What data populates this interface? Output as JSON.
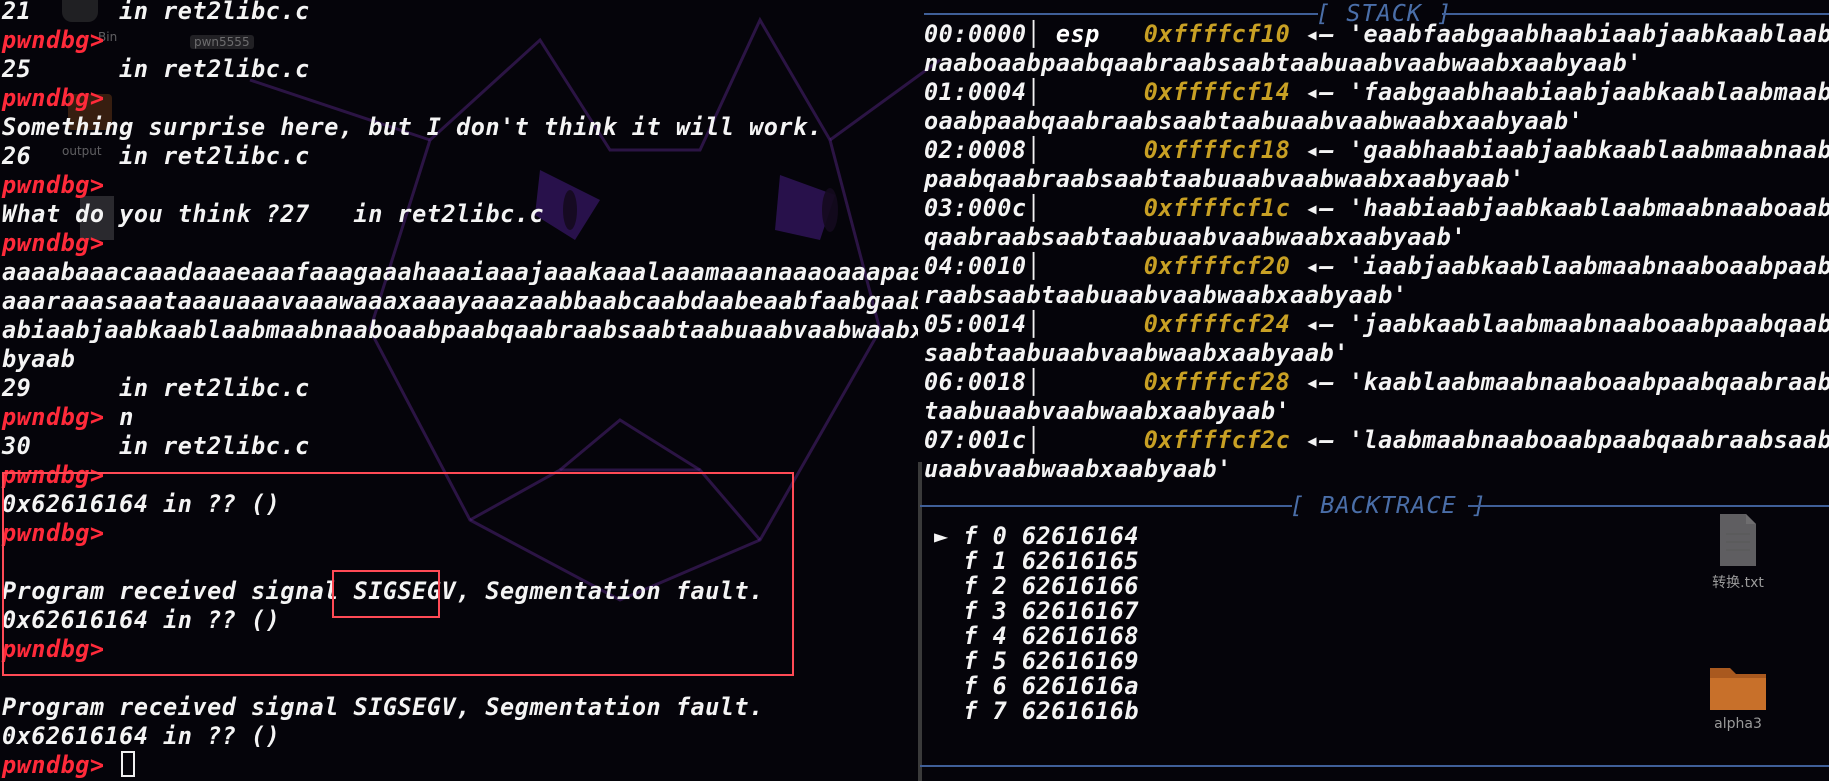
{
  "left_terminal": {
    "lines": [
      {
        "kind": "text",
        "text": "21      in ret2libc.c"
      },
      {
        "kind": "prompt",
        "prompt": "pwndbg>",
        "text": ""
      },
      {
        "kind": "text",
        "text": "25      in ret2libc.c"
      },
      {
        "kind": "prompt",
        "prompt": "pwndbg>",
        "text": ""
      },
      {
        "kind": "text",
        "text": "Something surprise here, but I don't think it will work."
      },
      {
        "kind": "text",
        "text": "26      in ret2libc.c"
      },
      {
        "kind": "prompt",
        "prompt": "pwndbg>",
        "text": ""
      },
      {
        "kind": "text",
        "text": "What do you think ?27   in ret2libc.c"
      },
      {
        "kind": "prompt",
        "prompt": "pwndbg>",
        "text": ""
      },
      {
        "kind": "text",
        "text": "aaaabaaacaaadaaaeaaafaaagaaahaaaiaaajaaakaaalaaamaaanaaaoaaapaaaq"
      },
      {
        "kind": "text",
        "text": "aaaraaasaaataaauaaavaaawaaaxaaayaaazaabbaabcaabdaabeaabfaabgaabha"
      },
      {
        "kind": "text",
        "text": "abiaabjaabkaablaabmaabnaaboaabpaabqaabraabsaabtaabuaabvaabwaabxaa"
      },
      {
        "kind": "text",
        "text": "byaab"
      },
      {
        "kind": "text",
        "text": "29      in ret2libc.c"
      },
      {
        "kind": "prompt",
        "prompt": "pwndbg>",
        "text": " n"
      },
      {
        "kind": "text",
        "text": "30      in ret2libc.c"
      },
      {
        "kind": "prompt",
        "prompt": "pwndbg>",
        "text": ""
      },
      {
        "kind": "text",
        "text": "0x62616164 in ?? ()"
      },
      {
        "kind": "prompt",
        "prompt": "pwndbg>",
        "text": ""
      },
      {
        "kind": "text",
        "text": ""
      },
      {
        "kind": "text",
        "text": "Program received signal SIGSEGV, Segmentation fault."
      },
      {
        "kind": "text",
        "text": "0x62616164 in ?? ()"
      },
      {
        "kind": "prompt",
        "prompt": "pwndbg>",
        "text": ""
      },
      {
        "kind": "text",
        "text": ""
      },
      {
        "kind": "text",
        "text": "Program received signal SIGSEGV, Segmentation fault."
      },
      {
        "kind": "text",
        "text": "0x62616164 in ?? ()"
      },
      {
        "kind": "prompt",
        "prompt": "pwndbg>",
        "text": " ",
        "cursor": true
      }
    ]
  },
  "stack_panel": {
    "title": "[ STACK ]",
    "rows": [
      {
        "offset": "00:0000",
        "reg": "esp",
        "addr": "0xffffcf10",
        "arrow": "◂—",
        "value": "'eaabfaabgaabhaabiaabjaabkaablaabmaab",
        "cont": "naaboaabpaabqaabraabsaabtaabuaabvaabwaabxaabyaab'"
      },
      {
        "offset": "01:0004",
        "reg": "",
        "addr": "0xffffcf14",
        "arrow": "◂—",
        "value": "'faabgaabhaabiaabjaabkaablaabmaabnaab",
        "cont": "oaabpaabqaabraabsaabtaabuaabvaabwaabxaabyaab'"
      },
      {
        "offset": "02:0008",
        "reg": "",
        "addr": "0xffffcf18",
        "arrow": "◂—",
        "value": "'gaabhaabiaabjaabkaablaabmaabnaaboaab",
        "cont": "paabqaabraabsaabtaabuaabvaabwaabxaabyaab'"
      },
      {
        "offset": "03:000c",
        "reg": "",
        "addr": "0xffffcf1c",
        "arrow": "◂—",
        "value": "'haabiaabjaabkaablaabmaabnaaboaabpaab",
        "cont": "qaabraabsaabtaabuaabvaabwaabxaabyaab'"
      },
      {
        "offset": "04:0010",
        "reg": "",
        "addr": "0xffffcf20",
        "arrow": "◂—",
        "value": "'iaabjaabkaablaabmaabnaaboaabpaabqaab",
        "cont": "raabsaabtaabuaabvaabwaabxaabyaab'"
      },
      {
        "offset": "05:0014",
        "reg": "",
        "addr": "0xffffcf24",
        "arrow": "◂—",
        "value": "'jaabkaablaabmaabnaaboaabpaabqaabraab",
        "cont": "saabtaabuaabvaabwaabxaabyaab'"
      },
      {
        "offset": "06:0018",
        "reg": "",
        "addr": "0xffffcf28",
        "arrow": "◂—",
        "value": "'kaablaabmaabnaaboaabpaabqaabraabsaab",
        "cont": "taabuaabvaabwaabxaabyaab'"
      },
      {
        "offset": "07:001c",
        "reg": "",
        "addr": "0xffffcf2c",
        "arrow": "◂—",
        "value": "'laabmaabnaaboaabpaabqaabraabsaabtaab",
        "cont": "uaabvaabwaabxaabyaab'"
      }
    ]
  },
  "backtrace_panel": {
    "title": "[ BACKTRACE ]",
    "frames": [
      {
        "marker": "►",
        "label": "f 0",
        "addr": "62616164"
      },
      {
        "marker": "",
        "label": "f 1",
        "addr": "62616165"
      },
      {
        "marker": "",
        "label": "f 2",
        "addr": "62616166"
      },
      {
        "marker": "",
        "label": "f 3",
        "addr": "62616167"
      },
      {
        "marker": "",
        "label": "f 4",
        "addr": "62616168"
      },
      {
        "marker": "",
        "label": "f 5",
        "addr": "62616169"
      },
      {
        "marker": "",
        "label": "f 6",
        "addr": "6261616a"
      },
      {
        "marker": "",
        "label": "f 7",
        "addr": "6261616b"
      }
    ]
  },
  "desktop_icons": [
    {
      "name": "txt-file",
      "label": "转换.txt",
      "icon": "document-icon"
    },
    {
      "name": "folder",
      "label": "alpha3",
      "icon": "folder-icon"
    }
  ],
  "desktop_faint_labels": {
    "bin": "Bin",
    "pwn": "pwn5555",
    "output": "output"
  },
  "colors": {
    "prompt": "#ff2a3a",
    "address": "#c8a024",
    "header": "#4a6ea8",
    "highlight_box": "#ff4a55",
    "text": "#f4f4f4"
  }
}
